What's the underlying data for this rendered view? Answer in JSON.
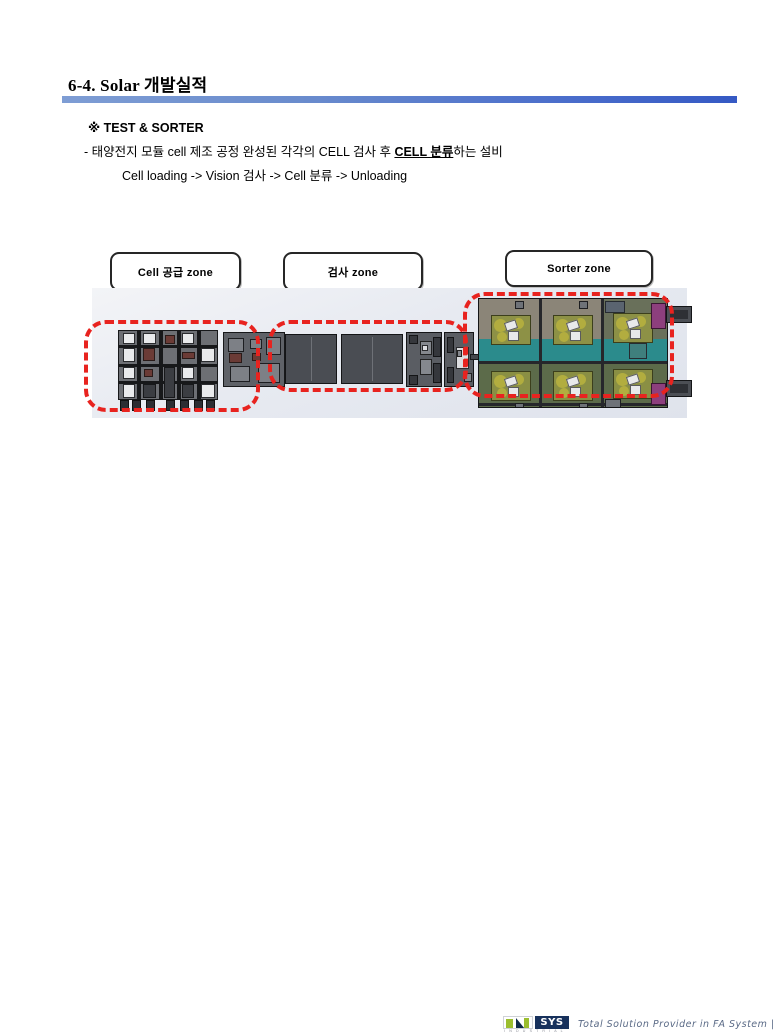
{
  "slide": {
    "title_main": "6-4. Solar ",
    "title_kr": "개발실적",
    "accent_bar_color": "#4a6dcb"
  },
  "body": {
    "line1": "※ TEST & SORTER",
    "line2_pre": "- 태양전지  모듈 cell 제조 공정  완성된 각각의 CELL 검사 후  ",
    "line2_em": "CELL  분류",
    "line2_post": "하는 설비",
    "line3": "Cell loading -> Vision 검사  ->  Cell 분류  -> Unloading"
  },
  "zones": [
    {
      "id": "cell",
      "label": "Cell 공급  zone"
    },
    {
      "id": "inspection",
      "label": "검사  zone"
    },
    {
      "id": "sorter",
      "label": "Sorter zone"
    }
  ],
  "diagram": {
    "highlight_color": "#e8231f",
    "panel_bg": "#e7eaf1",
    "teal_band": "#2b8b8c",
    "regions": [
      {
        "name": "cell-supply-region",
        "zone": "Cell 공급  zone"
      },
      {
        "name": "inspection-region",
        "zone": "검사  zone"
      },
      {
        "name": "sorter-region",
        "zone": "Sorter zone"
      }
    ]
  },
  "footer": {
    "logo_in": "IN",
    "logo_sys": "SYS",
    "logo_sub": "I N D U S T R I A L",
    "tagline": "Total Solution Provider in FA System |"
  }
}
